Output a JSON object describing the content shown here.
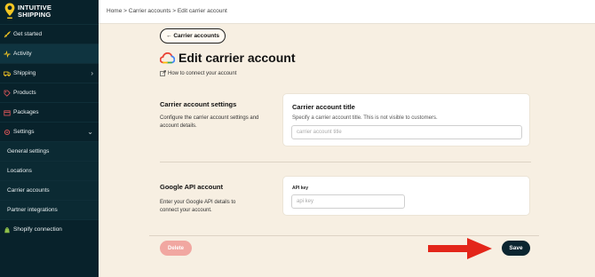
{
  "brand": {
    "line1": "INTUITIVE",
    "line2": "SHIPPING"
  },
  "sidebar": {
    "items": [
      {
        "label": "Get started",
        "icon": "rocket-icon"
      },
      {
        "label": "Activity",
        "icon": "activity-icon"
      },
      {
        "label": "Shipping",
        "icon": "truck-icon"
      },
      {
        "label": "Products",
        "icon": "tag-icon"
      },
      {
        "label": "Packages",
        "icon": "package-icon"
      },
      {
        "label": "Settings",
        "icon": "gear-icon"
      },
      {
        "label": "General settings"
      },
      {
        "label": "Locations"
      },
      {
        "label": "Carrier accounts"
      },
      {
        "label": "Partner integrations"
      },
      {
        "label": "Shopify connection",
        "icon": "shopify-icon"
      }
    ]
  },
  "breadcrumb": "Home > Carrier accounts > Edit carrier account",
  "back_button": "← Carrier accounts",
  "page_title": "Edit carrier account",
  "help_link": "How to connect your account",
  "sections": {
    "carrier_settings": {
      "title": "Carrier account settings",
      "description": "Configure the carrier account settings and account details.",
      "card_title": "Carrier account title",
      "card_help": "Specify a carrier account title. This is not visible to customers.",
      "input_placeholder": "carrier account title"
    },
    "google_api": {
      "title": "Google API account",
      "description": "Enter your Google API details to connect your account.",
      "field_label": "API key",
      "input_placeholder": "api key"
    }
  },
  "buttons": {
    "delete": "Delete",
    "save": "Save"
  },
  "colors": {
    "sidebar": "#08222b",
    "background": "#f7efe2",
    "save": "#0b2530",
    "delete": "#f1a7a1",
    "arrow": "#e3261a"
  }
}
